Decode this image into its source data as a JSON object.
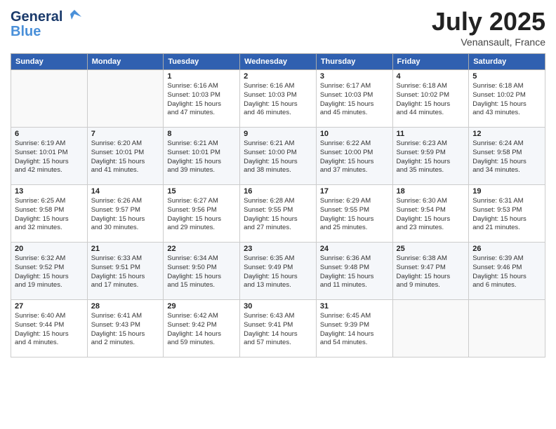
{
  "header": {
    "logo_general": "General",
    "logo_blue": "Blue",
    "month": "July 2025",
    "location": "Venansault, France"
  },
  "weekdays": [
    "Sunday",
    "Monday",
    "Tuesday",
    "Wednesday",
    "Thursday",
    "Friday",
    "Saturday"
  ],
  "weeks": [
    [
      {
        "day": "",
        "info": ""
      },
      {
        "day": "",
        "info": ""
      },
      {
        "day": "1",
        "info": "Sunrise: 6:16 AM\nSunset: 10:03 PM\nDaylight: 15 hours\nand 47 minutes."
      },
      {
        "day": "2",
        "info": "Sunrise: 6:16 AM\nSunset: 10:03 PM\nDaylight: 15 hours\nand 46 minutes."
      },
      {
        "day": "3",
        "info": "Sunrise: 6:17 AM\nSunset: 10:03 PM\nDaylight: 15 hours\nand 45 minutes."
      },
      {
        "day": "4",
        "info": "Sunrise: 6:18 AM\nSunset: 10:02 PM\nDaylight: 15 hours\nand 44 minutes."
      },
      {
        "day": "5",
        "info": "Sunrise: 6:18 AM\nSunset: 10:02 PM\nDaylight: 15 hours\nand 43 minutes."
      }
    ],
    [
      {
        "day": "6",
        "info": "Sunrise: 6:19 AM\nSunset: 10:01 PM\nDaylight: 15 hours\nand 42 minutes."
      },
      {
        "day": "7",
        "info": "Sunrise: 6:20 AM\nSunset: 10:01 PM\nDaylight: 15 hours\nand 41 minutes."
      },
      {
        "day": "8",
        "info": "Sunrise: 6:21 AM\nSunset: 10:01 PM\nDaylight: 15 hours\nand 39 minutes."
      },
      {
        "day": "9",
        "info": "Sunrise: 6:21 AM\nSunset: 10:00 PM\nDaylight: 15 hours\nand 38 minutes."
      },
      {
        "day": "10",
        "info": "Sunrise: 6:22 AM\nSunset: 10:00 PM\nDaylight: 15 hours\nand 37 minutes."
      },
      {
        "day": "11",
        "info": "Sunrise: 6:23 AM\nSunset: 9:59 PM\nDaylight: 15 hours\nand 35 minutes."
      },
      {
        "day": "12",
        "info": "Sunrise: 6:24 AM\nSunset: 9:58 PM\nDaylight: 15 hours\nand 34 minutes."
      }
    ],
    [
      {
        "day": "13",
        "info": "Sunrise: 6:25 AM\nSunset: 9:58 PM\nDaylight: 15 hours\nand 32 minutes."
      },
      {
        "day": "14",
        "info": "Sunrise: 6:26 AM\nSunset: 9:57 PM\nDaylight: 15 hours\nand 30 minutes."
      },
      {
        "day": "15",
        "info": "Sunrise: 6:27 AM\nSunset: 9:56 PM\nDaylight: 15 hours\nand 29 minutes."
      },
      {
        "day": "16",
        "info": "Sunrise: 6:28 AM\nSunset: 9:55 PM\nDaylight: 15 hours\nand 27 minutes."
      },
      {
        "day": "17",
        "info": "Sunrise: 6:29 AM\nSunset: 9:55 PM\nDaylight: 15 hours\nand 25 minutes."
      },
      {
        "day": "18",
        "info": "Sunrise: 6:30 AM\nSunset: 9:54 PM\nDaylight: 15 hours\nand 23 minutes."
      },
      {
        "day": "19",
        "info": "Sunrise: 6:31 AM\nSunset: 9:53 PM\nDaylight: 15 hours\nand 21 minutes."
      }
    ],
    [
      {
        "day": "20",
        "info": "Sunrise: 6:32 AM\nSunset: 9:52 PM\nDaylight: 15 hours\nand 19 minutes."
      },
      {
        "day": "21",
        "info": "Sunrise: 6:33 AM\nSunset: 9:51 PM\nDaylight: 15 hours\nand 17 minutes."
      },
      {
        "day": "22",
        "info": "Sunrise: 6:34 AM\nSunset: 9:50 PM\nDaylight: 15 hours\nand 15 minutes."
      },
      {
        "day": "23",
        "info": "Sunrise: 6:35 AM\nSunset: 9:49 PM\nDaylight: 15 hours\nand 13 minutes."
      },
      {
        "day": "24",
        "info": "Sunrise: 6:36 AM\nSunset: 9:48 PM\nDaylight: 15 hours\nand 11 minutes."
      },
      {
        "day": "25",
        "info": "Sunrise: 6:38 AM\nSunset: 9:47 PM\nDaylight: 15 hours\nand 9 minutes."
      },
      {
        "day": "26",
        "info": "Sunrise: 6:39 AM\nSunset: 9:46 PM\nDaylight: 15 hours\nand 6 minutes."
      }
    ],
    [
      {
        "day": "27",
        "info": "Sunrise: 6:40 AM\nSunset: 9:44 PM\nDaylight: 15 hours\nand 4 minutes."
      },
      {
        "day": "28",
        "info": "Sunrise: 6:41 AM\nSunset: 9:43 PM\nDaylight: 15 hours\nand 2 minutes."
      },
      {
        "day": "29",
        "info": "Sunrise: 6:42 AM\nSunset: 9:42 PM\nDaylight: 14 hours\nand 59 minutes."
      },
      {
        "day": "30",
        "info": "Sunrise: 6:43 AM\nSunset: 9:41 PM\nDaylight: 14 hours\nand 57 minutes."
      },
      {
        "day": "31",
        "info": "Sunrise: 6:45 AM\nSunset: 9:39 PM\nDaylight: 14 hours\nand 54 minutes."
      },
      {
        "day": "",
        "info": ""
      },
      {
        "day": "",
        "info": ""
      }
    ]
  ]
}
